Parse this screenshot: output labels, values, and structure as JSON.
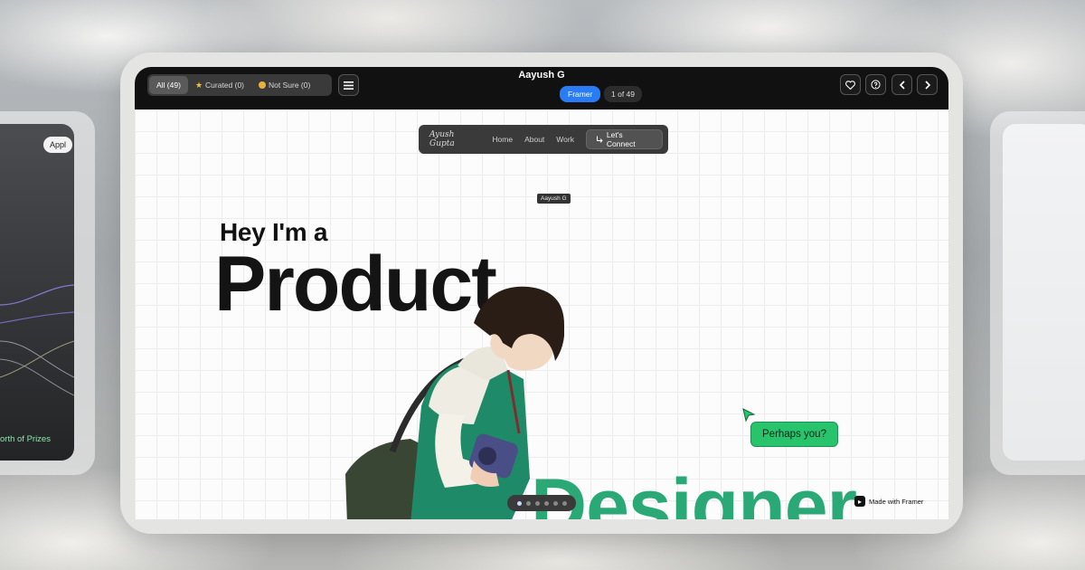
{
  "left_preview": {
    "pill": "Appl",
    "prize_text": "orth of Prizes"
  },
  "topbar": {
    "filters": [
      {
        "label": "All (49)"
      },
      {
        "label": "Curated (0)"
      },
      {
        "label": "Not Sure (0)"
      }
    ],
    "title": "Aayush G",
    "tool_badge": "Framer",
    "position": "1 of 49"
  },
  "site": {
    "nav": {
      "brand": "Ayush Gupta",
      "links": [
        "Home",
        "About",
        "Work"
      ],
      "connect": "Let's Connect"
    },
    "tag": "Aayush G",
    "hero_line1": "Hey I'm a",
    "hero_line2": "Product",
    "hero_line3": "Designer",
    "bubble": "Perhaps you?",
    "made_with": "Made with Framer"
  },
  "colors": {
    "accent_blue": "#2a7cf6",
    "designer_green": "#2aa876",
    "bubble_green": "#27c46c",
    "topbar": "#111111"
  },
  "pager": {
    "total": 6,
    "active": 1
  }
}
